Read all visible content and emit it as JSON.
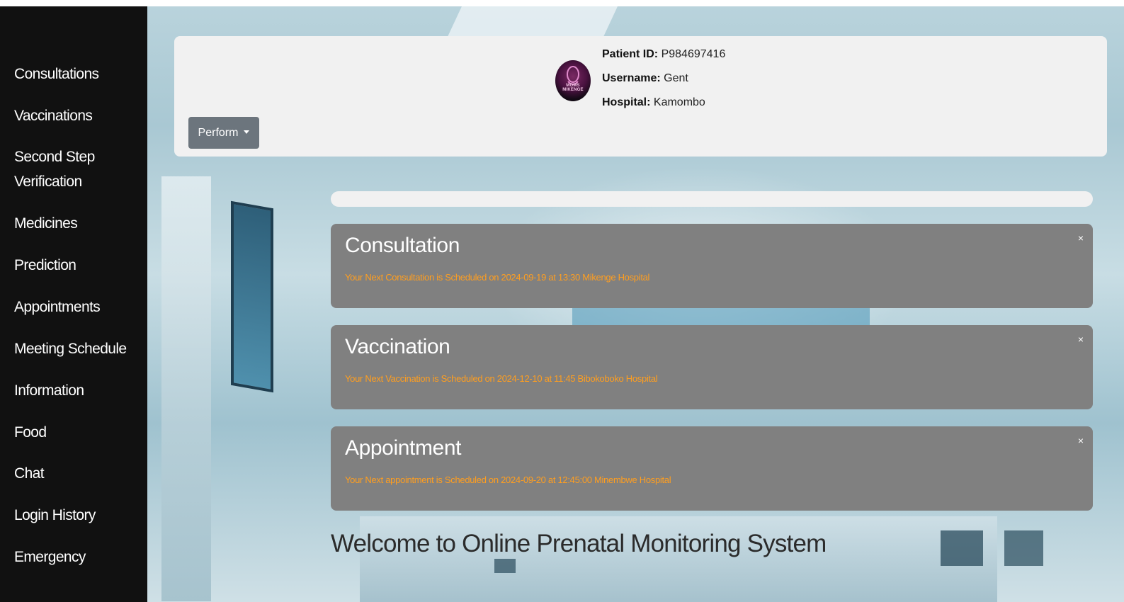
{
  "sidebar": {
    "items": [
      {
        "label": "Consultations"
      },
      {
        "label": "Vaccinations"
      },
      {
        "label": "Second Step Verification"
      },
      {
        "label": "Medicines"
      },
      {
        "label": "Prediction"
      },
      {
        "label": "Appointments"
      },
      {
        "label": "Meeting Schedule"
      },
      {
        "label": "Information"
      },
      {
        "label": "Food"
      },
      {
        "label": "Chat"
      },
      {
        "label": "Login History"
      },
      {
        "label": "Emergency"
      }
    ]
  },
  "header": {
    "avatar_text": "MOMS MIKENGE",
    "patient_id_label": "Patient ID:",
    "patient_id": "P984697416",
    "username_label": "Username:",
    "username": "Gent",
    "hospital_label": "Hospital:",
    "hospital": "Kamombo",
    "perform_label": "Perform"
  },
  "alerts": [
    {
      "title": "Consultation",
      "message": "Your Next Consultation is Scheduled on 2024-09-19 at 13:30 Mikenge Hospital",
      "close": "×"
    },
    {
      "title": "Vaccination",
      "message": "Your Next Vaccination is Scheduled on 2024-12-10 at 11:45 Bibokoboko Hospital",
      "close": "×"
    },
    {
      "title": "Appointment",
      "message": "Your Next appointment is Scheduled on 2024-09-20 at 12:45:00 Minembwe Hospital",
      "close": "×"
    }
  ],
  "welcome_text": "Welcome to Online Prenatal Monitoring System",
  "colors": {
    "sidebar_bg": "#111111",
    "alert_bg": "#808080",
    "alert_message": "#ff9e1f",
    "button_bg": "#6c757d"
  }
}
